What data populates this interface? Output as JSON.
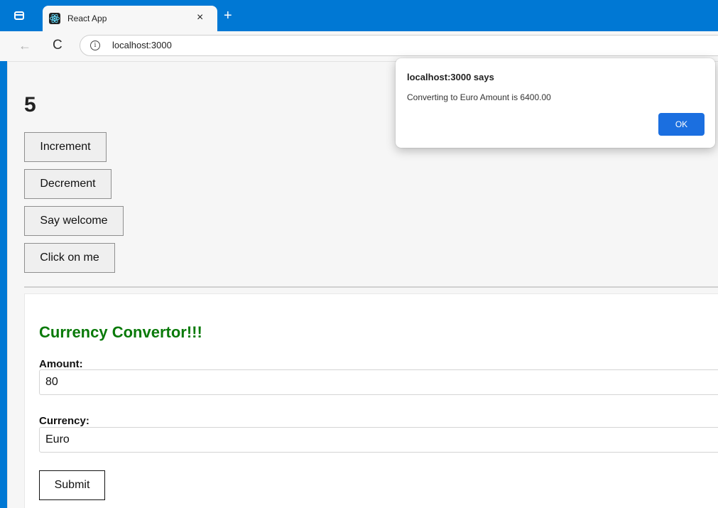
{
  "browser": {
    "tab_title": "React App",
    "tab_close": "×",
    "new_tab": "+",
    "url": "localhost:3000",
    "icons": {
      "tab_actions": "tab-actions-icon",
      "favicon": "react-logo-icon",
      "back": "arrow-left-icon",
      "reload": "reload-icon",
      "info": "info-icon"
    },
    "glyphs": {
      "back": "←",
      "reload": "C",
      "info": "i"
    }
  },
  "counter": {
    "value": "5",
    "buttons": {
      "increment": "Increment",
      "decrement": "Decrement",
      "say_welcome": "Say welcome",
      "click_on_me": "Click on me"
    }
  },
  "converter": {
    "title": "Currency Convertor!!!",
    "amount_label": "Amount:",
    "amount_value": "80",
    "currency_label": "Currency:",
    "currency_value": "Euro",
    "submit_label": "Submit",
    "title_color": "#0a7a0a"
  },
  "alert": {
    "title": "localhost:3000 says",
    "message": "Converting to Euro Amount is 6400.00",
    "ok_label": "OK",
    "ok_color": "#1b6fe0"
  },
  "colors": {
    "tabstrip": "#0078d4",
    "page_background": "#f6f6f6"
  }
}
